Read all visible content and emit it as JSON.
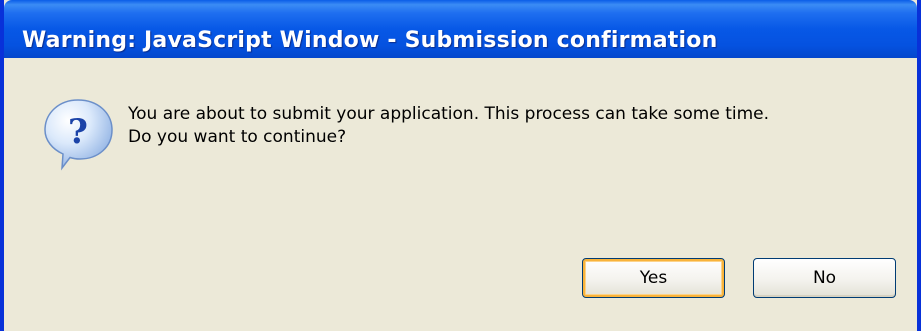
{
  "window": {
    "title": "Warning: JavaScript Window - Submission confirmation",
    "accent_color": "#0831d9",
    "body_color": "#ece9d8"
  },
  "dialog": {
    "icon": "question-icon",
    "message_line1": "You are about to submit your application. This process can take some time.",
    "message_line2": "Do you want to continue?"
  },
  "buttons": {
    "yes_label": "Yes",
    "no_label": "No",
    "default": "Yes"
  }
}
